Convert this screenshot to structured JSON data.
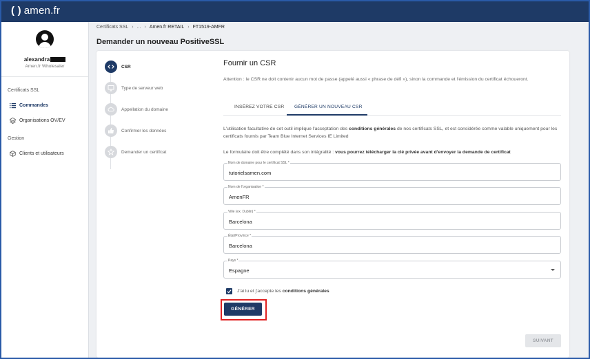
{
  "app": {
    "logo_paren": "( )",
    "logo_text": "amen.fr"
  },
  "user": {
    "name": "alexandra",
    "role": "Amen.fr Wholesaler"
  },
  "sidebar": {
    "section_ssl": "Certificats SSL",
    "items_ssl": [
      {
        "label": "Commandes",
        "icon": "list-icon",
        "active": true
      },
      {
        "label": "Organisations OV/EV",
        "icon": "layers-icon",
        "active": false
      }
    ],
    "section_gestion": "Gestion",
    "items_gestion": [
      {
        "label": "Clients et utilisateurs",
        "icon": "cube-icon",
        "active": false
      }
    ]
  },
  "breadcrumb": {
    "items": [
      "Certificats SSL",
      "...",
      "Amen.fr RETAIL",
      "FT1519-AMFR"
    ]
  },
  "page_title": "Demander un nouveau PositiveSSL",
  "stepper": {
    "steps": [
      {
        "label": "CSR",
        "icon": "code-icon",
        "active": true
      },
      {
        "label": "Type de serveur web",
        "icon": "monitor-icon",
        "active": false
      },
      {
        "label": "Appellation du domaine",
        "icon": "cloud-icon",
        "active": false
      },
      {
        "label": "Confirmer les données",
        "icon": "thumbs-up-icon",
        "active": false
      },
      {
        "label": "Demander un certificat",
        "icon": "star-icon",
        "active": false
      }
    ]
  },
  "form": {
    "title": "Fournir un CSR",
    "warning": "Attention : le CSR ne doit contenir aucun mot de passe (appelé aussi « phrase de défi »), sinon la commande et l'émission du certificat échoueront.",
    "tabs": [
      {
        "label": "INSÉREZ VOTRE CSR",
        "active": false
      },
      {
        "label": "GÉNÉRER UN NOUVEAU CSR",
        "active": true
      }
    ],
    "para1_a": "L'utilisation facultative de cet outil implique l'acceptation des ",
    "para1_b": "conditions générales",
    "para1_c": " de nos certificats SSL, et est considérée comme valable uniquement pour les certificats fournis par Team Blue Internet Services IE Limited",
    "para2_a": "Le formulaire doit être complété dans son intégralité : ",
    "para2_b": "vous pourrez télécharger la clé privée avant d'envoyer la demande de certificat",
    "fields": {
      "domain": {
        "label": "Nom de domaine pour le certificat SSL *",
        "value": "tutorielsamen.com"
      },
      "org": {
        "label": "Nom de l'organisation *",
        "value": "AmenFR"
      },
      "city": {
        "label": "Ville (ex. Dublin) *",
        "value": "Barcelona"
      },
      "state": {
        "label": "État/Province *",
        "value": "Barcelona"
      },
      "country": {
        "label": "Pays *",
        "value": "Espagne"
      }
    },
    "consent_a": "J'ai lu et j'accepte les ",
    "consent_b": "conditions générales",
    "consent_checked": true,
    "generate_label": "GÉNÉRER",
    "next_label": "SUIVANT"
  },
  "colors": {
    "primary": "#1e3a66",
    "highlight": "#e02020",
    "disabled_bg": "#e4e6e9"
  }
}
